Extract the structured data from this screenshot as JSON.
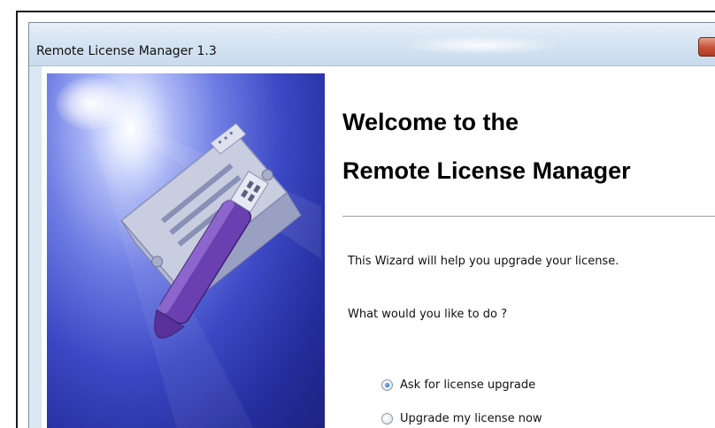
{
  "window": {
    "title": "Remote License Manager 1.3"
  },
  "banner": {
    "description_icon": "usb-dongle-illustration"
  },
  "content": {
    "heading_line1": "Welcome to the",
    "heading_line2": "Remote License Manager",
    "intro_text": "This Wizard will help you upgrade your license.",
    "question_text": "What would you like to do ?",
    "options": [
      {
        "label": "Ask for license upgrade",
        "selected": true
      },
      {
        "label": "Upgrade my license now",
        "selected": false
      }
    ]
  },
  "colors": {
    "banner_dark": "#1d237e",
    "banner_mid": "#3c48c4",
    "titlebar": "#d6e4f2",
    "close_button": "#c8553c",
    "dongle_purple": "#6a3fb0"
  }
}
